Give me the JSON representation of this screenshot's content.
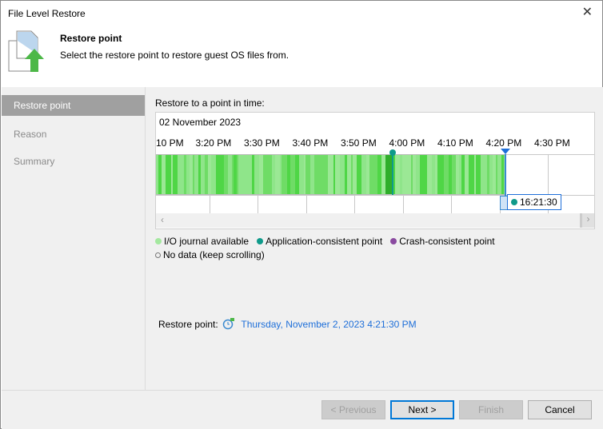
{
  "window": {
    "title": "File Level Restore"
  },
  "header": {
    "title": "Restore point",
    "subtitle": "Select the restore point to restore guest OS files from."
  },
  "sidebar": {
    "items": [
      {
        "label": "Restore point",
        "active": true
      },
      {
        "label": "Reason"
      },
      {
        "label": "Summary"
      }
    ]
  },
  "main": {
    "label": "Restore to a point in time:",
    "date": "02 November 2023",
    "ticks": [
      "10 PM",
      "3:20 PM",
      "3:30 PM",
      "3:40 PM",
      "3:50 PM",
      "4:00 PM",
      "4:10 PM",
      "4:20 PM",
      "4:30 PM"
    ],
    "selected_time": "16:21:30",
    "legend": [
      "I/O journal available",
      "Application-consistent point",
      "Crash-consistent point",
      "No data (keep scrolling)"
    ],
    "restore_point_label": "Restore point:",
    "restore_point_value": "Thursday, November 2, 2023 4:21:30 PM",
    "colors": {
      "journal": "#8fe58a",
      "app": "#0f9a8a",
      "crash": "#8a4aa0",
      "link": "#1e6fd9"
    }
  },
  "footer": {
    "previous": "< Previous",
    "next": "Next >",
    "finish": "Finish",
    "cancel": "Cancel"
  }
}
